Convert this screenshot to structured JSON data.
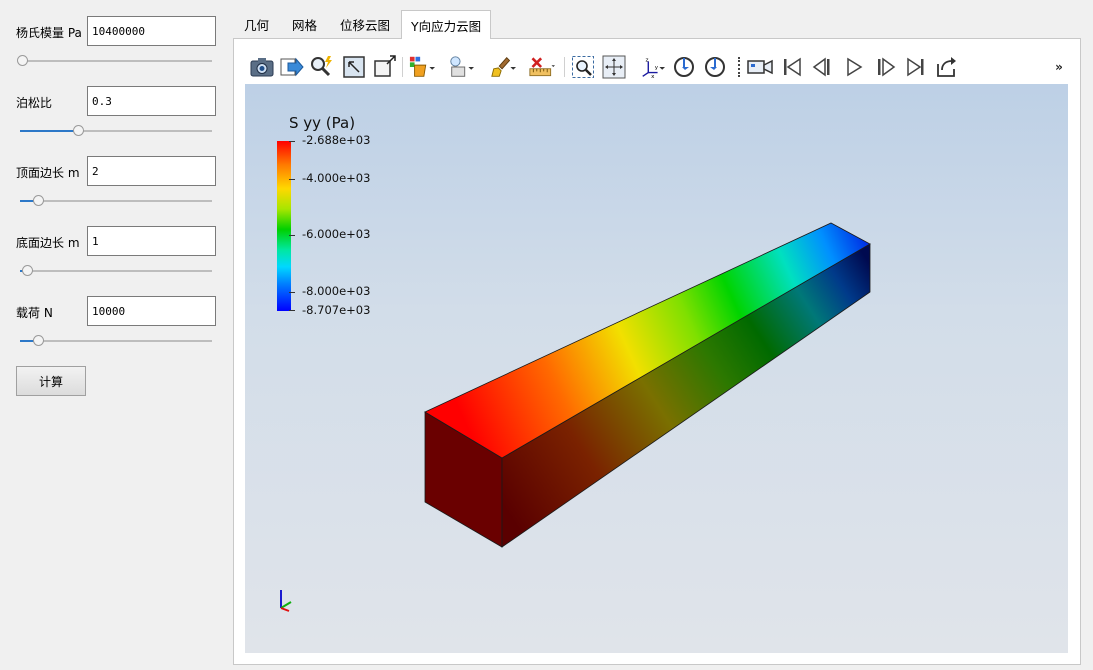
{
  "params": {
    "youngs_modulus": {
      "label": "杨氏模量 Pa",
      "value": "10400000",
      "slider_fraction": 0.0
    },
    "poisson_ratio": {
      "label": "泊松比",
      "value": "0.3",
      "slider_fraction": 0.3
    },
    "top_edge": {
      "label": "顶面边长 m",
      "value": "2",
      "slider_fraction": 0.09
    },
    "bottom_edge": {
      "label": "底面边长 m",
      "value": "1",
      "slider_fraction": 0.04
    },
    "load": {
      "label": "载荷 N",
      "value": "10000",
      "slider_fraction": 0.09
    }
  },
  "calculate_label": "计算",
  "tabs": [
    {
      "label": "几何",
      "active": false
    },
    {
      "label": "网格",
      "active": false
    },
    {
      "label": "位移云图",
      "active": false
    },
    {
      "label": "Y向应力云图",
      "active": true
    }
  ],
  "toolbar": {
    "icons": [
      "camera-icon",
      "export-icon",
      "probe-icon",
      "select-surface-icon",
      "select-points-icon",
      "color-map-icon",
      "lighting-icon",
      "paint-brush-icon",
      "ruler-delete-icon",
      "zoom-box-icon",
      "reset-view-icon",
      "axes-icon",
      "rotate-cw-icon",
      "rotate-ccw-icon",
      "video-camera-icon",
      "first-frame-icon",
      "previous-frame-icon",
      "play-icon",
      "next-frame-icon",
      "last-frame-icon",
      "loop-icon"
    ],
    "overflow": "»"
  },
  "legend": {
    "title": "S yy (Pa)",
    "labels": [
      "-2.688e+03",
      "-4.000e+03",
      "-6.000e+03",
      "-8.000e+03",
      "-8.707e+03"
    ],
    "colors": [
      "#ff0000",
      "#ffd800",
      "#00d000",
      "#00d8ff",
      "#0000ff"
    ]
  }
}
